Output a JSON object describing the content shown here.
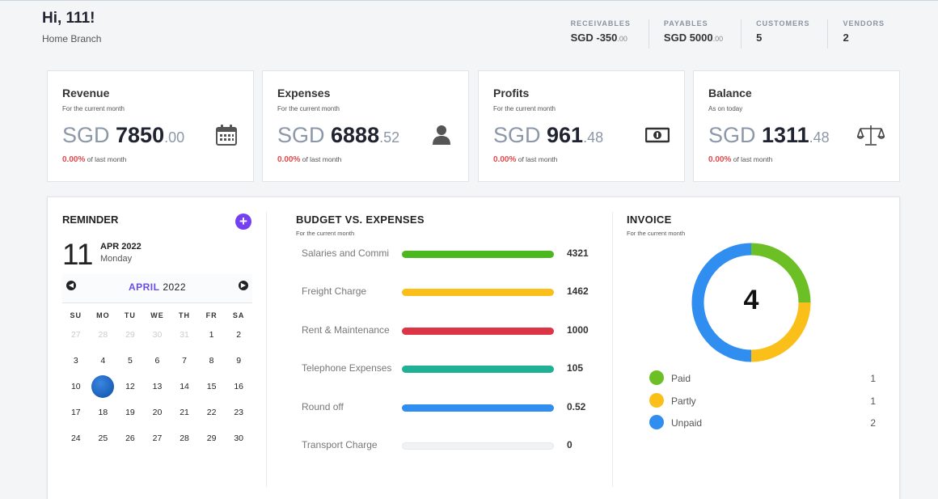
{
  "header": {
    "greeting": "Hi, 111!",
    "branch": "Home Branch"
  },
  "stats": [
    {
      "label": "RECEIVABLES",
      "value": "SGD -350",
      "cents": ".00"
    },
    {
      "label": "PAYABLES",
      "value": "SGD 5000",
      "cents": ".00"
    },
    {
      "label": "CUSTOMERS",
      "value": "5",
      "cents": ""
    },
    {
      "label": "VENDORS",
      "value": "2",
      "cents": ""
    }
  ],
  "cards": [
    {
      "title": "Revenue",
      "subtitle": "For the current month",
      "currency": "SGD ",
      "whole": "7850",
      "cents": ".00",
      "change": "0.00%",
      "change_label": " of last month",
      "icon": "calendar-icon"
    },
    {
      "title": "Expenses",
      "subtitle": "For the current month",
      "currency": "SGD ",
      "whole": "6888",
      "cents": ".52",
      "change": "0.00%",
      "change_label": " of last month",
      "icon": "user-icon"
    },
    {
      "title": "Profits",
      "subtitle": "For the current month",
      "currency": "SGD ",
      "whole": "961",
      "cents": ".48",
      "change": "0.00%",
      "change_label": " of last month",
      "icon": "money-icon"
    },
    {
      "title": "Balance",
      "subtitle": "As on today",
      "currency": "SGD ",
      "whole": "1311",
      "cents": ".48",
      "change": "0.00%",
      "change_label": " of last month",
      "icon": "balance-scale-icon"
    }
  ],
  "reminder": {
    "title": "REMINDER",
    "add_icon": "plus-circle-icon",
    "day": "11",
    "month_year": "APR 2022",
    "weekday": "Monday",
    "calendar_month": "APRIL",
    "calendar_year": "2022",
    "weekdays": [
      "SU",
      "MO",
      "TU",
      "WE",
      "TH",
      "FR",
      "SA"
    ],
    "weeks": [
      [
        [
          "27",
          true
        ],
        [
          "28",
          true
        ],
        [
          "29",
          true
        ],
        [
          "30",
          true
        ],
        [
          "31",
          true
        ],
        [
          "1",
          false
        ],
        [
          "2",
          false
        ]
      ],
      [
        [
          "3",
          false
        ],
        [
          "4",
          false
        ],
        [
          "5",
          false
        ],
        [
          "6",
          false
        ],
        [
          "7",
          false
        ],
        [
          "8",
          false
        ],
        [
          "9",
          false
        ]
      ],
      [
        [
          "10",
          false
        ],
        [
          "11",
          false
        ],
        [
          "12",
          false
        ],
        [
          "13",
          false
        ],
        [
          "14",
          false
        ],
        [
          "15",
          false
        ],
        [
          "16",
          false
        ]
      ],
      [
        [
          "17",
          false
        ],
        [
          "18",
          false
        ],
        [
          "19",
          false
        ],
        [
          "20",
          false
        ],
        [
          "21",
          false
        ],
        [
          "22",
          false
        ],
        [
          "23",
          false
        ]
      ],
      [
        [
          "24",
          false
        ],
        [
          "25",
          false
        ],
        [
          "26",
          false
        ],
        [
          "27",
          false
        ],
        [
          "28",
          false
        ],
        [
          "29",
          false
        ],
        [
          "30",
          false
        ]
      ]
    ],
    "selected_day": "11"
  },
  "budget": {
    "title": "BUDGET VS. EXPENSES",
    "subtitle": "For the current month",
    "items": [
      {
        "name": "Salaries and Commi",
        "value": "4321",
        "fraction": 1.0,
        "color": "#4cb81f"
      },
      {
        "name": "Freight Charge",
        "value": "1462",
        "fraction": 1.0,
        "color": "#fbbf1a"
      },
      {
        "name": "Rent & Maintenance",
        "value": "1000",
        "fraction": 1.0,
        "color": "#dc3545"
      },
      {
        "name": "Telephone Expenses",
        "value": "105",
        "fraction": 1.0,
        "color": "#20b096"
      },
      {
        "name": "Round off",
        "value": "0.52",
        "fraction": 1.0,
        "color": "#2f8ef0"
      },
      {
        "name": "Transport Charge",
        "value": "0",
        "fraction": 0.0,
        "color": "#2f8ef0"
      }
    ]
  },
  "invoice": {
    "title": "INVOICE",
    "subtitle": "For the current month",
    "total": "4",
    "legend": [
      {
        "name": "Paid",
        "count": "1",
        "value": 1,
        "color": "#6cbf24"
      },
      {
        "name": "Partly",
        "count": "1",
        "value": 1,
        "color": "#fbbf1a"
      },
      {
        "name": "Unpaid",
        "count": "2",
        "value": 2,
        "color": "#2f8ef0"
      }
    ]
  }
}
